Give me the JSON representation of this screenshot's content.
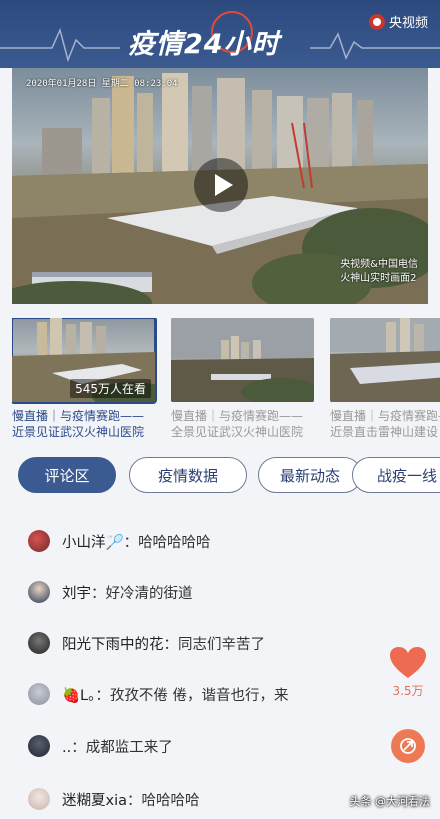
{
  "header": {
    "title": "疫情24小时",
    "brand": "央视频"
  },
  "video": {
    "timestamp": "2020年01月28日 星期二 08:23:04",
    "watermark_line1": "央视频&中国电信",
    "watermark_line2": "火神山实时画面2"
  },
  "thumbs": [
    {
      "viewers": "545万人在看",
      "caption": "慢直播｜与疫情赛跑——近景见证武汉火神山医院崛起"
    },
    {
      "caption": "慢直播｜与疫情赛跑——全景见证武汉火神山医院崛起"
    },
    {
      "caption": "慢直播｜与疫情赛跑——近景直击雷神山建设"
    }
  ],
  "tabs": [
    "评论区",
    "疫情数据",
    "最新动态",
    "战疫一线"
  ],
  "comments": [
    {
      "user": "小山洋🏸",
      "text": "哈哈哈哈哈"
    },
    {
      "user": "刘宇",
      "text": "好冷清的街道"
    },
    {
      "user": "阳光下雨中的花",
      "text": "同志们辛苦了"
    },
    {
      "user": "🍓L。",
      "text": "孜孜不倦 倦，谐音也行，来"
    },
    {
      "user": "..",
      "text": "成都监工来了"
    },
    {
      "user": "迷糊夏xia",
      "text": "哈哈哈哈"
    }
  ],
  "like_count": "3.5万",
  "source_watermark": "头条 @大河看法",
  "colors": {
    "header": "#2d4a7e",
    "accent": "#3c5a92",
    "like": "#e0705a",
    "share": "#ee7a55"
  }
}
